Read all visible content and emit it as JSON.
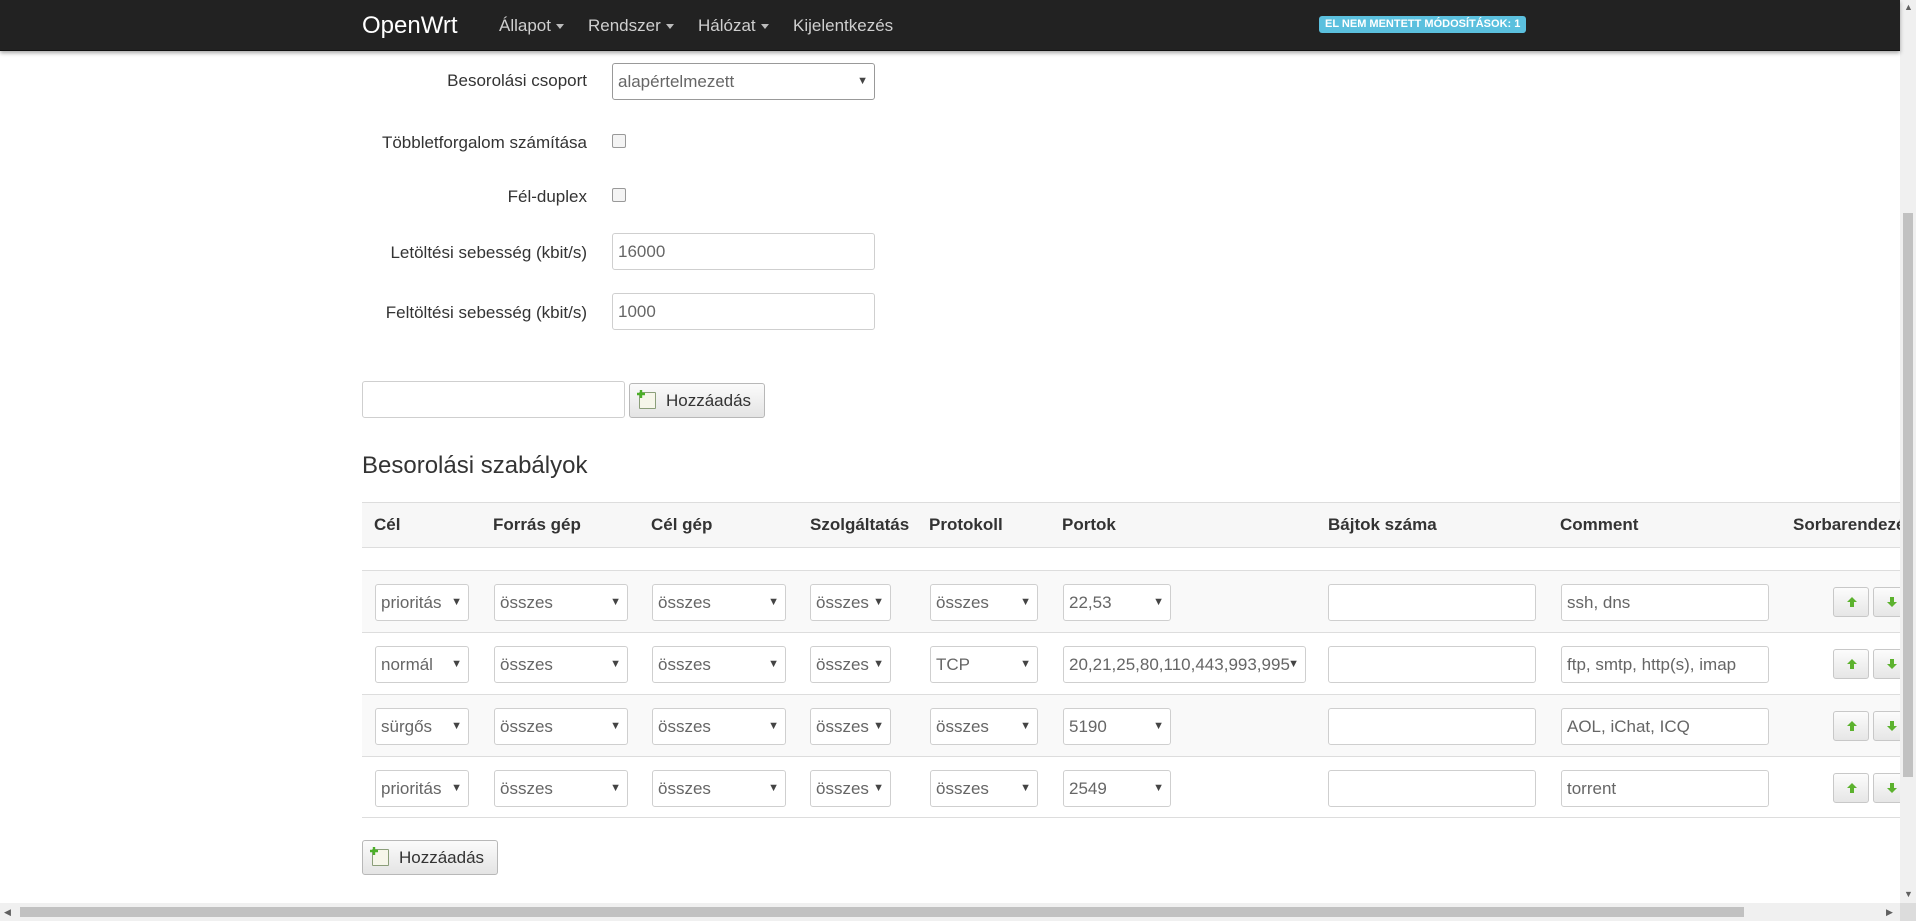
{
  "navbar": {
    "brand": "OpenWrt",
    "menus": [
      {
        "label": "Állapot"
      },
      {
        "label": "Rendszer"
      },
      {
        "label": "Hálózat"
      },
      {
        "label": "Kijelentkezés"
      }
    ],
    "unsaved_badge": "EL NEM MENTETT MÓDOSÍTÁSOK: 1"
  },
  "form": {
    "classgroup_label": "Besorolási csoport",
    "classgroup_value": "alapértelmezett",
    "overhead_label": "Többletforgalom számítása",
    "overhead_checked": false,
    "halfduplex_label": "Fél-duplex",
    "halfduplex_checked": false,
    "download_label": "Letöltési sebesség (kbit/s)",
    "download_placeholder": "16000",
    "upload_label": "Feltöltési sebesség (kbit/s)",
    "upload_placeholder": "1000"
  },
  "add_section": {
    "input_value": "",
    "button_label": "Hozzáadás"
  },
  "rules": {
    "title": "Besorolási szabályok",
    "headers": [
      "Cél",
      "Forrás gép",
      "Cél gép",
      "Szolgáltatás",
      "Protokoll",
      "Portok",
      "Bájtok száma",
      "Comment",
      "Sorbarendezé"
    ],
    "rows": [
      {
        "target": "prioritás",
        "src": "összes",
        "dst": "összes",
        "service": "összes",
        "proto": "összes",
        "ports": "22,53",
        "bytes": "",
        "comment": "ssh, dns"
      },
      {
        "target": "normál",
        "src": "összes",
        "dst": "összes",
        "service": "összes",
        "proto": "TCP",
        "ports": "20,21,25,80,110,443,993,995",
        "bytes": "",
        "comment": "ftp, smtp, http(s), imap"
      },
      {
        "target": "sürgős",
        "src": "összes",
        "dst": "összes",
        "service": "összes",
        "proto": "összes",
        "ports": "5190",
        "bytes": "",
        "comment": "AOL, iChat, ICQ"
      },
      {
        "target": "prioritás",
        "src": "összes",
        "dst": "összes",
        "service": "összes",
        "proto": "összes",
        "ports": "2549",
        "bytes": "",
        "comment": "torrent"
      }
    ],
    "add_button_label": "Hozzáadás"
  },
  "icons": {
    "dropdown_caret": "caret-down-icon",
    "add": "add-icon",
    "move_up": "arrow-up-icon",
    "move_down": "arrow-down-icon"
  },
  "colors": {
    "navbar_bg": "#222222",
    "badge_bg": "#5bc0de",
    "move_arrow": "#5cb22e"
  }
}
